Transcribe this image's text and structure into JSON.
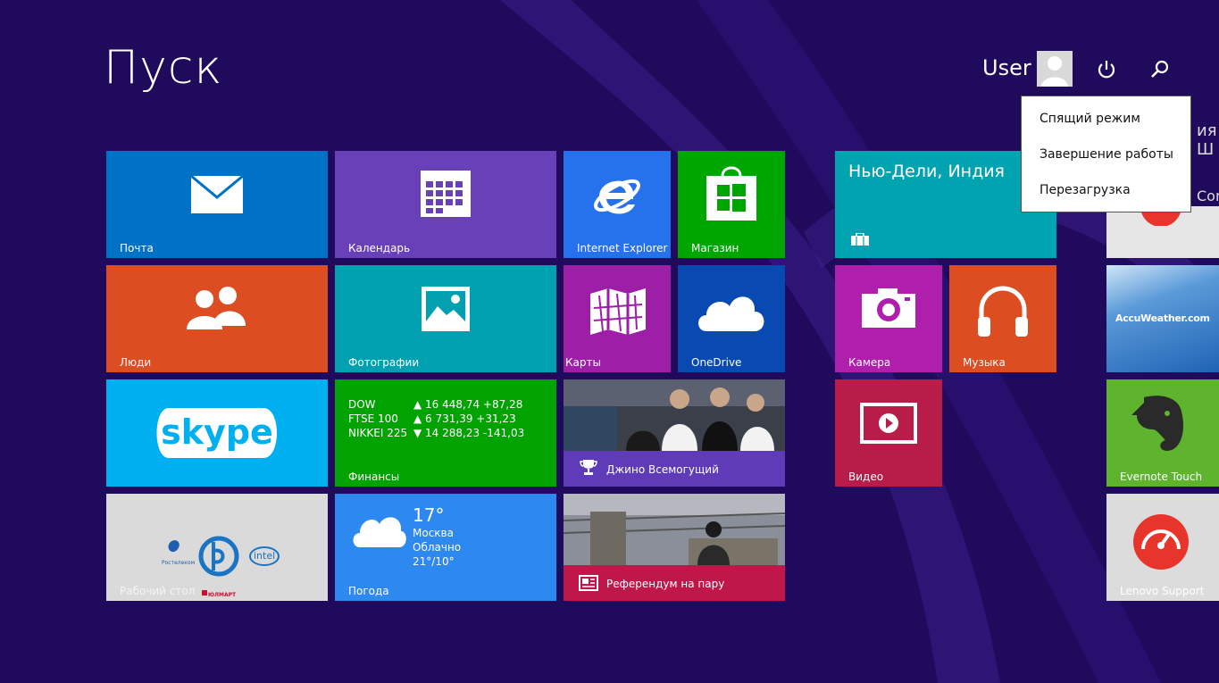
{
  "screen": {
    "title": "Пуск",
    "user_name": "User"
  },
  "power_menu": {
    "items": [
      "Спящий режим",
      "Завершение работы",
      "Перезагрузка"
    ]
  },
  "tiles": {
    "mail": "Почта",
    "calendar": "Календарь",
    "ie": "Internet Explorer",
    "store": "Магазин",
    "weather_city": "Нью-Дели, Индия",
    "people": "Люди",
    "photos": "Фотографии",
    "maps": "Карты",
    "onedrive": "OneDrive",
    "camera": "Камера",
    "music": "Музыка",
    "accuweather": "AccuWeather.com",
    "finance": {
      "label": "Финансы",
      "rows": [
        {
          "name": "DOW",
          "value": "▲ 16 448,74 +87,28"
        },
        {
          "name": "FTSE 100",
          "value": "▲ 6 731,39 +31,23"
        },
        {
          "name": "NIKKEI 225",
          "value": "▼ 14 288,23 -141,03"
        }
      ]
    },
    "sports_news": "Джино Всемогущий",
    "video": "Видео",
    "evernote": "Evernote Touch",
    "desktop": "Рабочий стол",
    "desktop_logos": [
      "Ростелеком",
      "intel",
      "ЮЛМАРТ"
    ],
    "weather": {
      "label": "Погода",
      "temp": "17°",
      "city": "Москва",
      "condition": "Облачно",
      "range": "21°/10°"
    },
    "news": "Референдум на пару",
    "lenovo": "Lenovo Support"
  },
  "partial_text": {
    "top": "ия Ш",
    "middle": "Cor"
  },
  "colors": {
    "background": "#1f0a5c",
    "mail": "#0072c6",
    "calendar": "#6841b8",
    "ie": "#2672ec",
    "store": "#00a600",
    "weather_city": "#00a4b0",
    "people": "#dc4d21",
    "photos": "#00a0b1",
    "maps": "#9d1fa8",
    "onedrive": "#094ab2",
    "camera": "#b01eac",
    "music": "#dc4d21",
    "skype": "#00aff0",
    "finance": "#00a300",
    "video": "#b81d4a",
    "evernote": "#5fb42d",
    "weather": "#2d89ef",
    "news": "#c0174a",
    "sports": "#5f3bb8"
  },
  "icons": {
    "power": "power-icon",
    "search": "search-icon",
    "mail": "envelope-icon",
    "calendar": "calendar-icon",
    "ie": "internet-explorer-icon",
    "store": "store-bag-icon",
    "briefcase": "briefcase-icon",
    "people": "people-icon",
    "photos": "photo-icon",
    "maps": "map-icon",
    "onedrive": "cloud-icon",
    "camera": "camera-icon",
    "music": "headphones-icon",
    "skype": "skype-logo",
    "video": "video-icon",
    "trophy": "trophy-icon",
    "news": "newspaper-icon",
    "evernote": "elephant-icon",
    "lenovo": "gauge-icon"
  }
}
